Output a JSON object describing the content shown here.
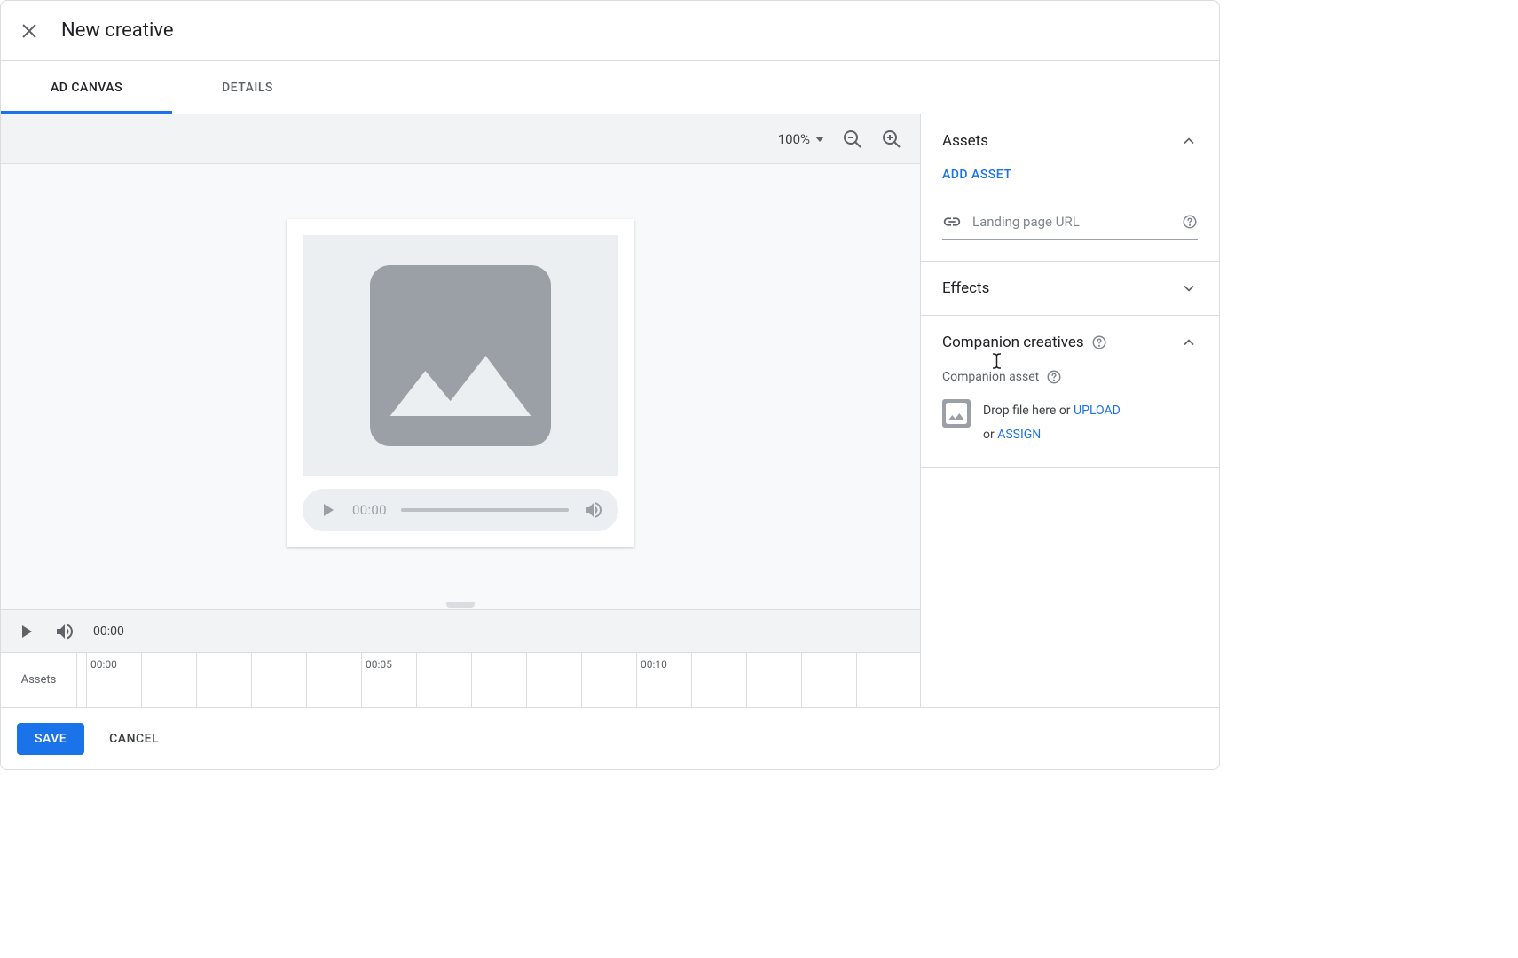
{
  "header": {
    "title": "New creative"
  },
  "tabs": {
    "items": [
      "AD CANVAS",
      "DETAILS"
    ],
    "active": 0
  },
  "canvas_toolbar": {
    "zoom": "100%"
  },
  "preview": {
    "time": "00:00"
  },
  "timeline": {
    "current_time": "00:00",
    "label": "Assets",
    "ticks": [
      "00:00",
      "00:05",
      "00:10"
    ]
  },
  "sidebar": {
    "assets": {
      "title": "Assets",
      "add_label": "ADD ASSET",
      "url_placeholder": "Landing page URL"
    },
    "effects": {
      "title": "Effects"
    },
    "companion": {
      "title": "Companion creatives",
      "asset_label": "Companion asset",
      "drop_prefix": "Drop file here or ",
      "upload": "UPLOAD",
      "or": "or ",
      "assign": "ASSIGN"
    }
  },
  "footer": {
    "save": "SAVE",
    "cancel": "CANCEL"
  }
}
